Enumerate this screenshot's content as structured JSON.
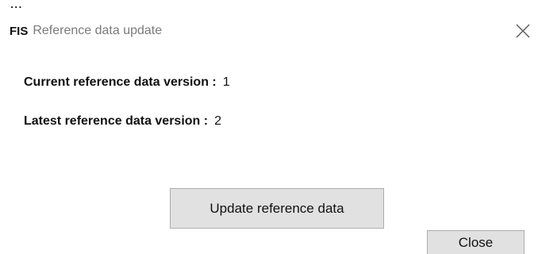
{
  "window": {
    "app_name": "FIS",
    "title": "Reference data update",
    "dots": "...",
    "close_icon": "close-x-icon"
  },
  "info": {
    "current_label": "Current reference data version :",
    "current_value": "1",
    "latest_label": "Latest reference data version :",
    "latest_value": "2"
  },
  "buttons": {
    "update_label": "Update reference data",
    "close_label": "Close"
  },
  "colors": {
    "background": "#ffffff",
    "button_face": "#e1e1e1",
    "button_border": "#adadad",
    "title_text": "#7a7a7a"
  }
}
